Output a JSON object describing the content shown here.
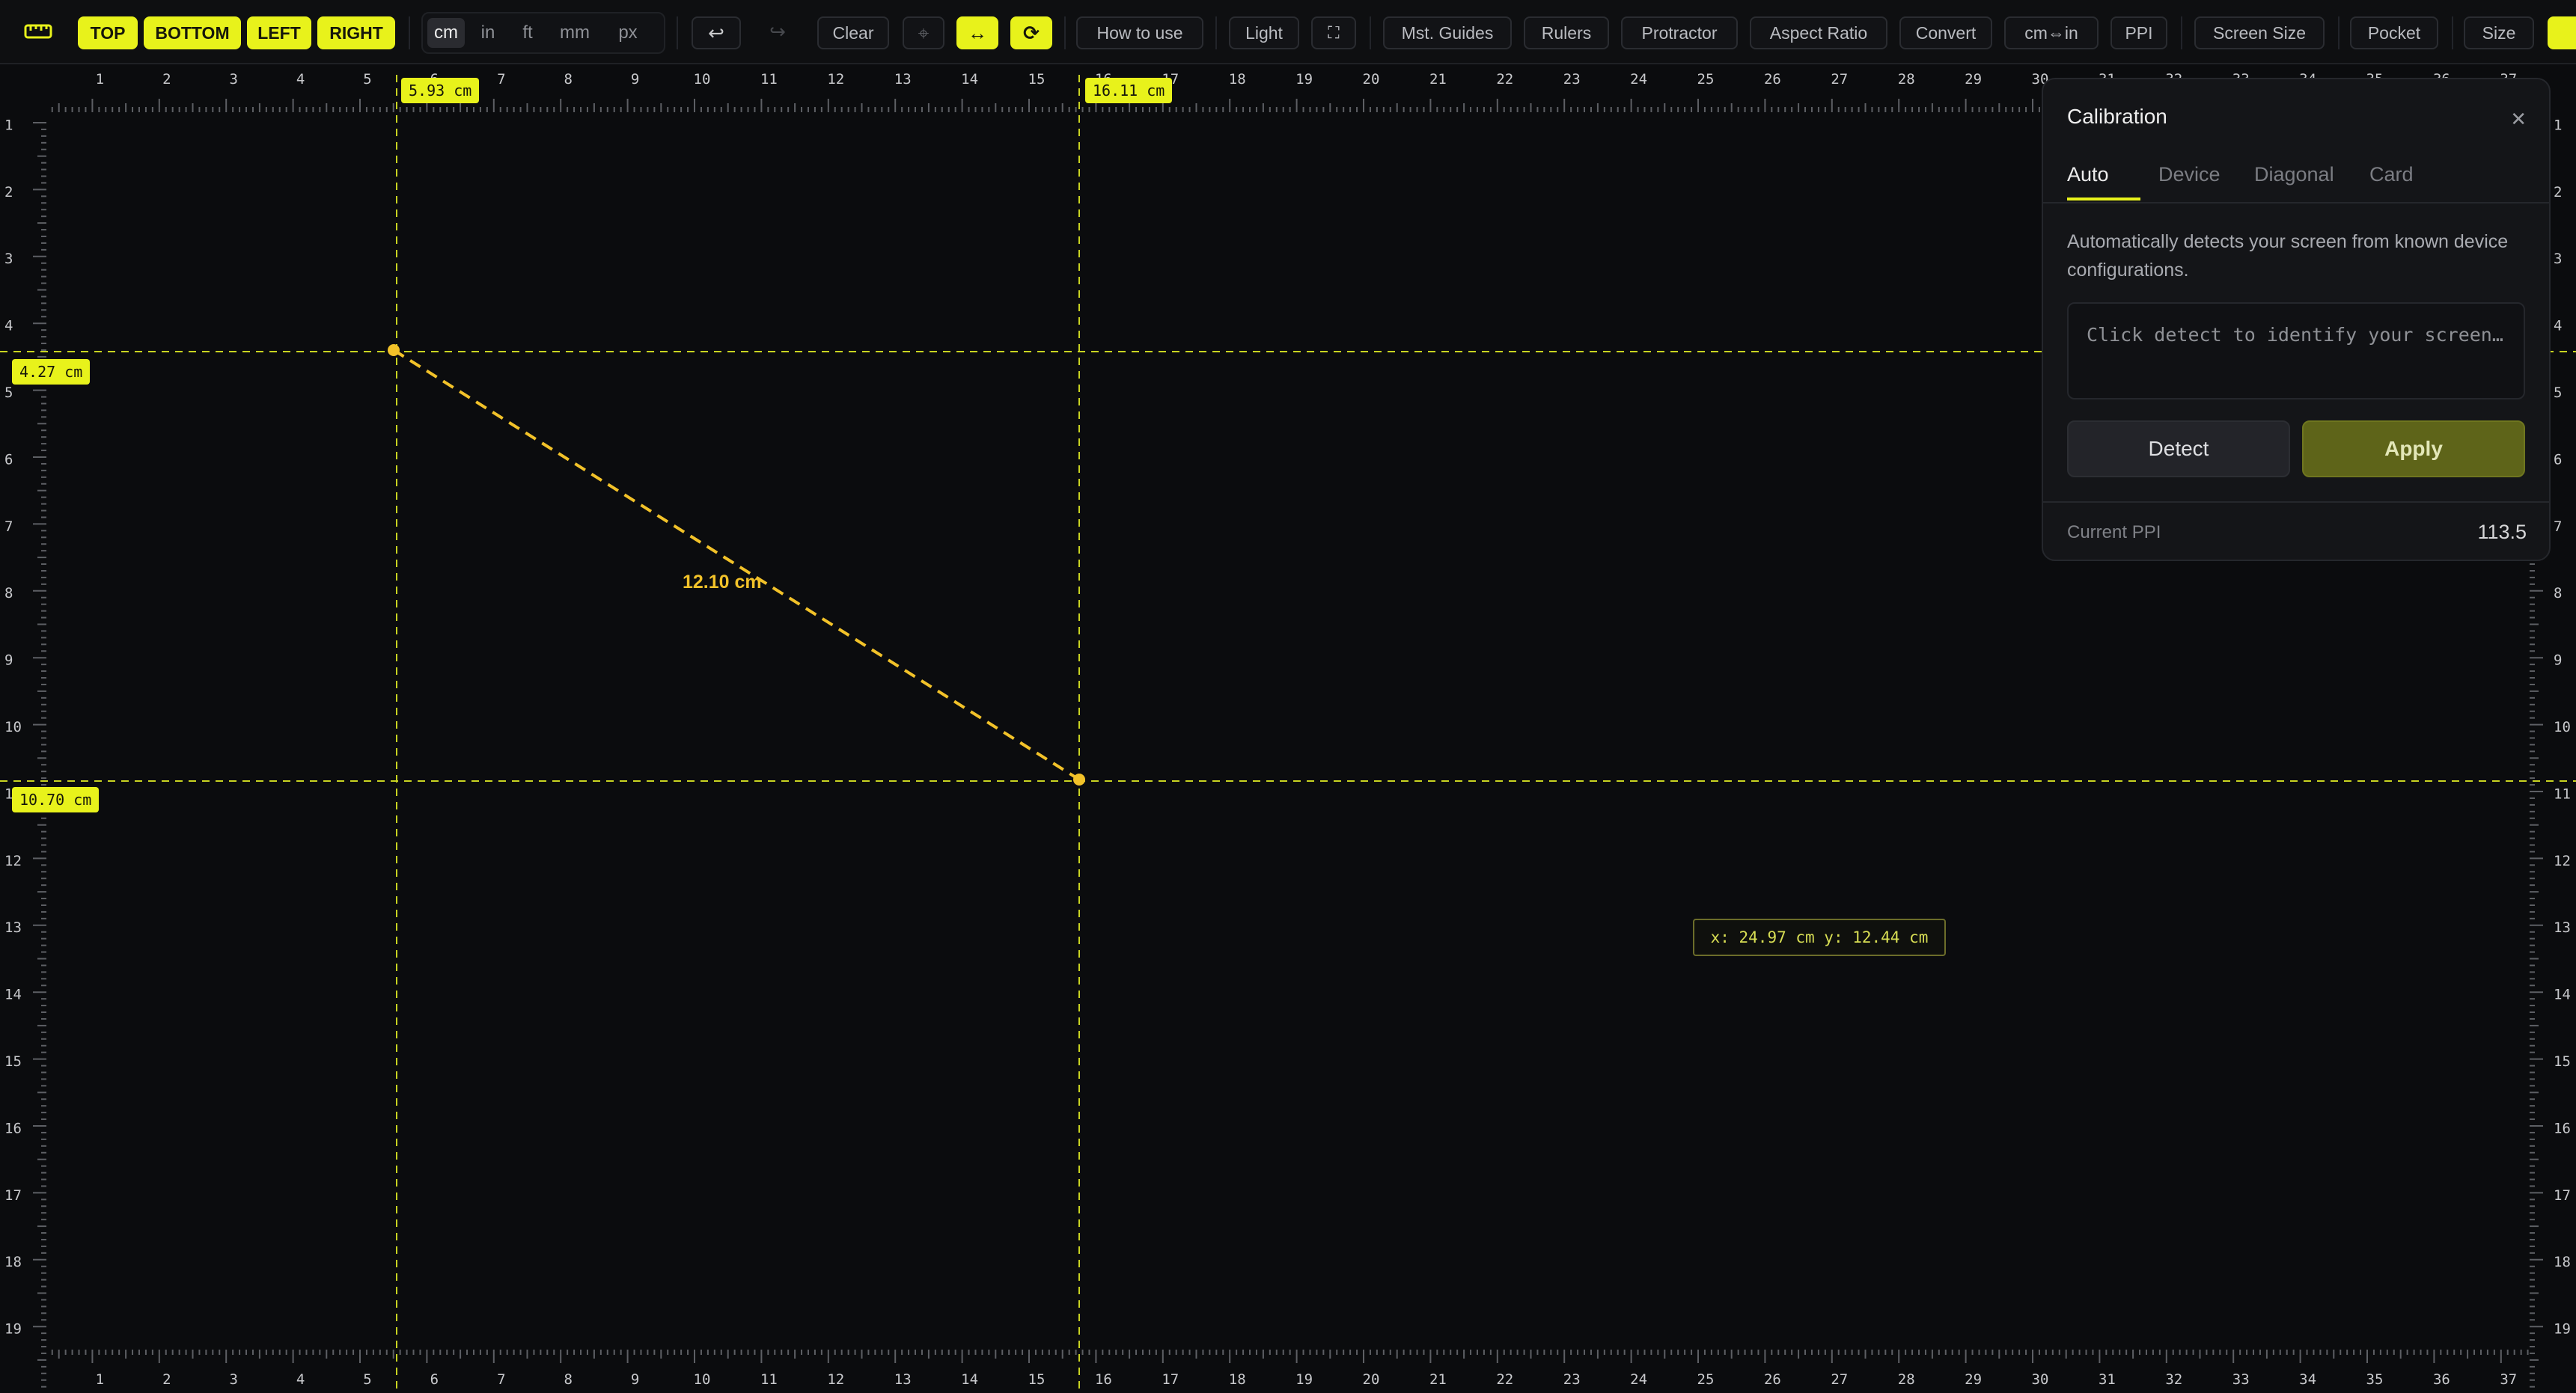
{
  "toolbar": {
    "edges": [
      "TOP",
      "BOTTOM",
      "LEFT",
      "RIGHT"
    ],
    "units": [
      "cm",
      "in",
      "ft",
      "mm",
      "px"
    ],
    "active_unit": "cm",
    "undo_icon": "undo-icon",
    "redo_icon": "redo-icon",
    "clear": "Clear",
    "crosshair_icon": "crosshair-icon",
    "swap_icon": "swap-horizontal-icon",
    "rotate_icon": "rotate-icon",
    "how_to_use": "How to use",
    "theme": "Light",
    "fullscreen_icon": "fullscreen-icon",
    "tools": [
      "Mst. Guides",
      "Rulers",
      "Protractor",
      "Aspect Ratio",
      "Convert",
      "cm⇔in",
      "PPI",
      "Screen Size",
      "Pocket",
      "Size"
    ]
  },
  "rulers": {
    "horizontal_ticks": [
      "1",
      "2",
      "3",
      "4",
      "5",
      "6",
      "7",
      "8",
      "9",
      "10",
      "11",
      "12",
      "13",
      "14",
      "15",
      "16",
      "17",
      "18",
      "19",
      "20",
      "21",
      "22",
      "23",
      "24",
      "25",
      "26",
      "27",
      "28",
      "29",
      "30",
      "31",
      "32",
      "33",
      "34",
      "35",
      "36",
      "37"
    ],
    "vertical_ticks": [
      "1",
      "2",
      "3",
      "4",
      "5",
      "6",
      "7",
      "8",
      "9",
      "10",
      "11",
      "12",
      "13",
      "14",
      "15",
      "16",
      "17",
      "18",
      "19"
    ]
  },
  "guides": {
    "v1": "5.93 cm",
    "v2": "16.11 cm",
    "h1": "4.27 cm",
    "h2": "10.70 cm"
  },
  "measurement": {
    "length": "12.10 cm"
  },
  "cursor_readout": "x: 24.97 cm y: 12.44 cm",
  "calibration": {
    "title": "Calibration",
    "close_icon": "close-icon",
    "tabs": [
      "Auto",
      "Device",
      "Diagonal",
      "Card"
    ],
    "active_tab": "Auto",
    "description": "Automatically detects your screen from known device configurations.",
    "detect_placeholder": "Click detect to identify your screen…",
    "detect_button": "Detect",
    "apply_button": "Apply",
    "ppi_label": "Current PPI",
    "ppi_value": "113.5"
  },
  "colors": {
    "accent": "#e8f21b",
    "measure_line": "#f2c229",
    "background": "#0b0c0e"
  }
}
